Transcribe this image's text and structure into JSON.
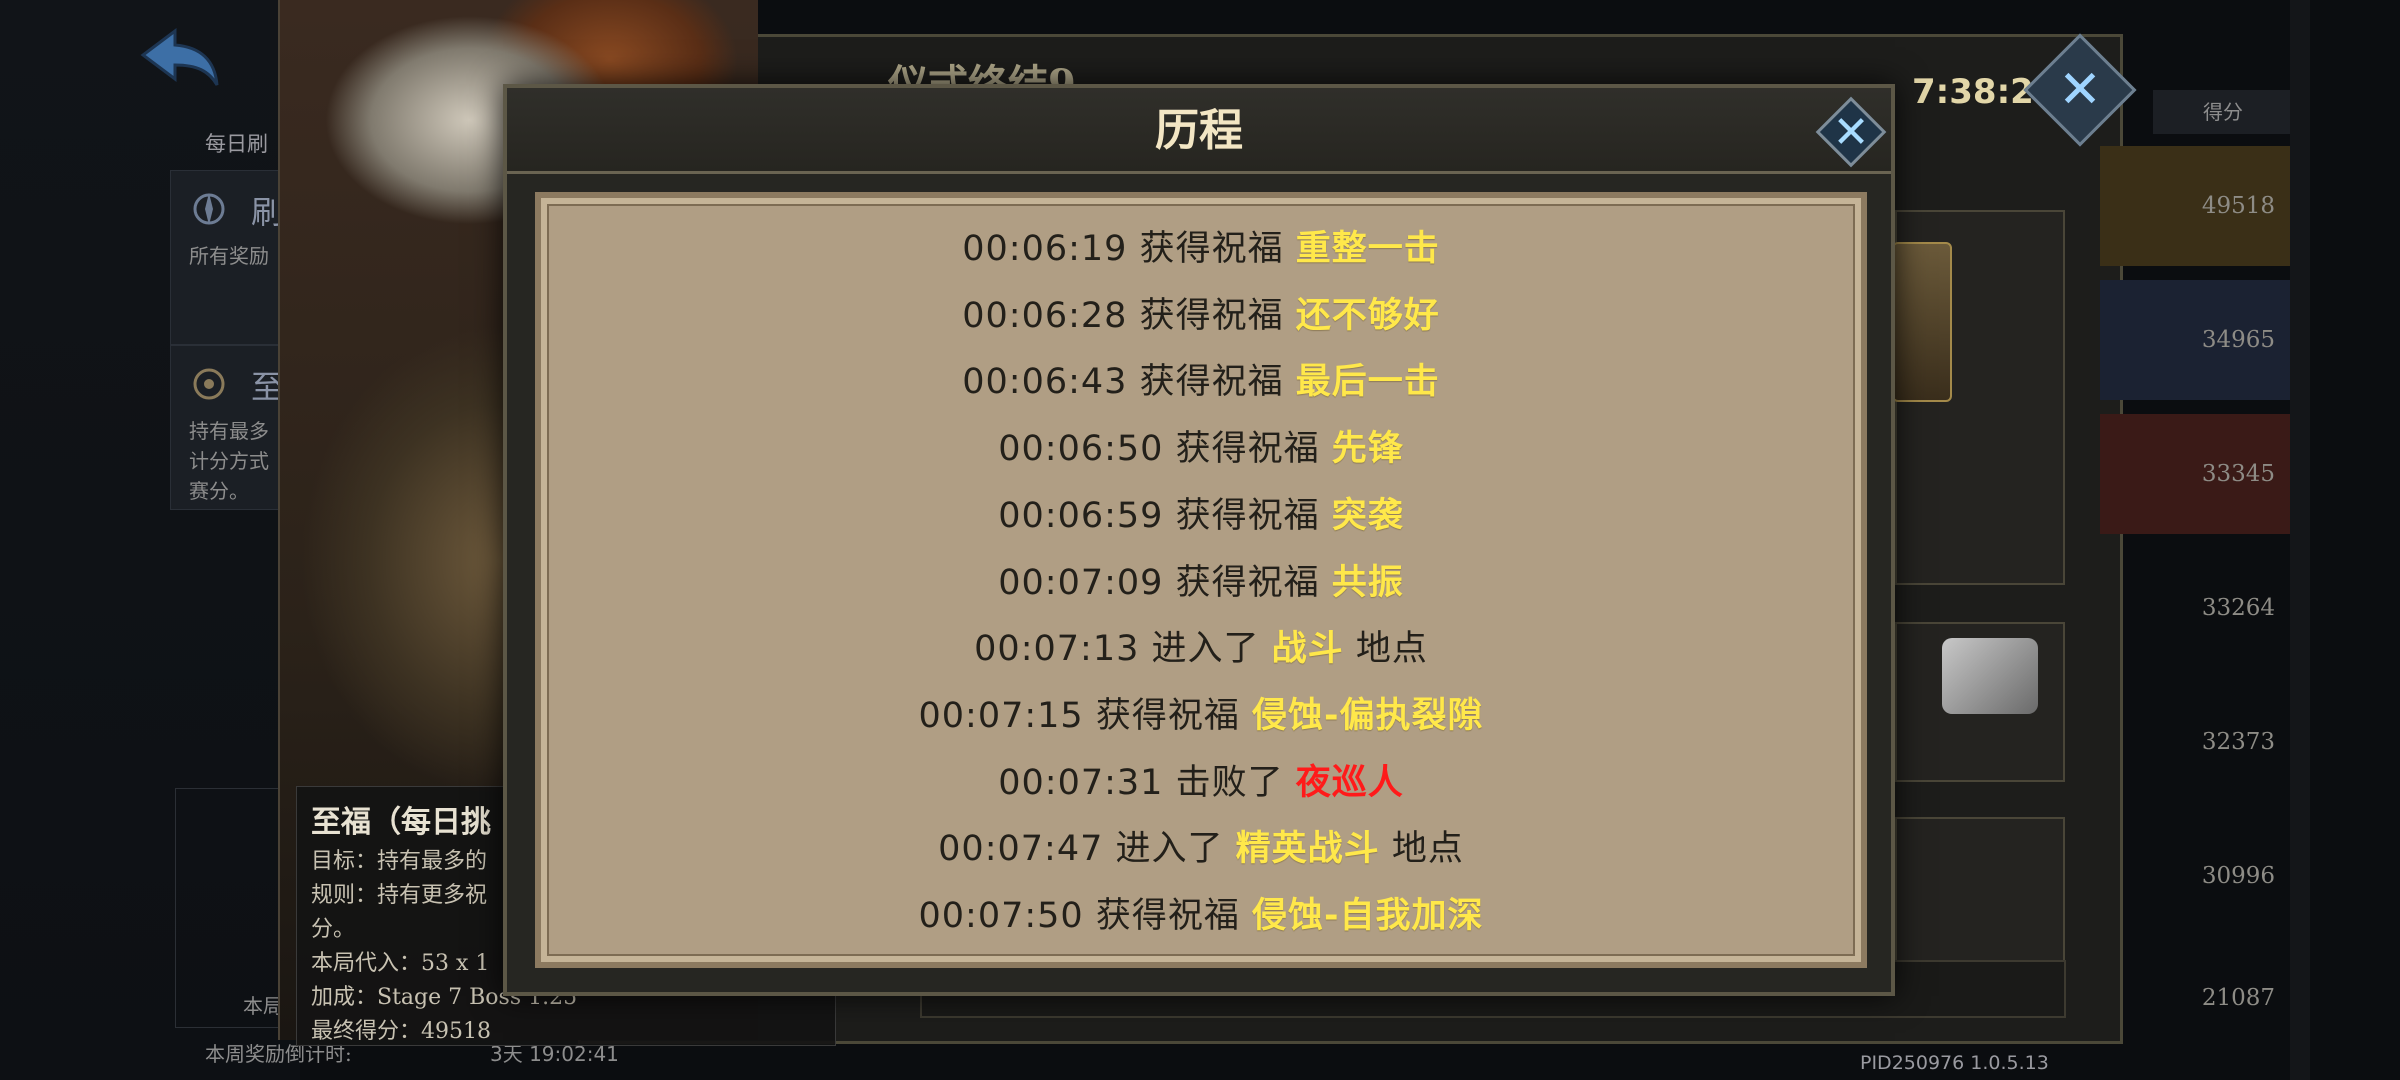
{
  "background": {
    "daily_label": "每日刷",
    "card1": {
      "title": "刷",
      "desc": "所有奖励"
    },
    "card2": {
      "title": "至",
      "desc_lines": [
        "持有最多",
        "计分方式",
        "赛分。"
      ]
    },
    "week_label": "本局",
    "week_countdown_label": "本周奖励倒计时:",
    "week_countdown": "3天 19:02:41",
    "panel_title": "仪式终结9",
    "timer": "7:38:24",
    "score_header": "得分",
    "scores": [
      "49518",
      "34965",
      "33345",
      "33264",
      "32373",
      "30996",
      "21087"
    ],
    "pid": "PID250976 1.0.5.13"
  },
  "tooltip": {
    "title": "至福（每日挑",
    "lines": [
      "目标：持有最多的",
      "规则：持有更多祝",
      "分。",
      "本局代入：53 x 1",
      "加成：Stage 7 Boss 1.25",
      "最终得分：49518"
    ]
  },
  "dialog": {
    "title": "历程",
    "close_icon": "close-x-icon",
    "entries": [
      {
        "time": "00:06:19",
        "action": "获得祝福",
        "target": "重整一击",
        "suffix": "",
        "color": "#ffe84a"
      },
      {
        "time": "00:06:28",
        "action": "获得祝福",
        "target": "还不够好",
        "suffix": "",
        "color": "#ffe84a"
      },
      {
        "time": "00:06:43",
        "action": "获得祝福",
        "target": "最后一击",
        "suffix": "",
        "color": "#ffe84a"
      },
      {
        "time": "00:06:50",
        "action": "获得祝福",
        "target": "先锋",
        "suffix": "",
        "color": "#ffe84a"
      },
      {
        "time": "00:06:59",
        "action": "获得祝福",
        "target": "突袭",
        "suffix": "",
        "color": "#ffe84a"
      },
      {
        "time": "00:07:09",
        "action": "获得祝福",
        "target": "共振",
        "suffix": "",
        "color": "#ffe84a"
      },
      {
        "time": "00:07:13",
        "action": "进入了",
        "target": "战斗",
        "suffix": "地点",
        "color": "#ffe84a"
      },
      {
        "time": "00:07:15",
        "action": "获得祝福",
        "target": "侵蚀-偏执裂隙",
        "suffix": "",
        "color": "#ffe84a"
      },
      {
        "time": "00:07:31",
        "action": "击败了",
        "target": "夜巡人",
        "suffix": "",
        "color": "#ff1a1a"
      },
      {
        "time": "00:07:47",
        "action": "进入了",
        "target": "精英战斗",
        "suffix": "地点",
        "color": "#ffe84a"
      },
      {
        "time": "00:07:50",
        "action": "获得祝福",
        "target": "侵蚀-自我加深",
        "suffix": "",
        "color": "#ffe84a"
      }
    ]
  }
}
